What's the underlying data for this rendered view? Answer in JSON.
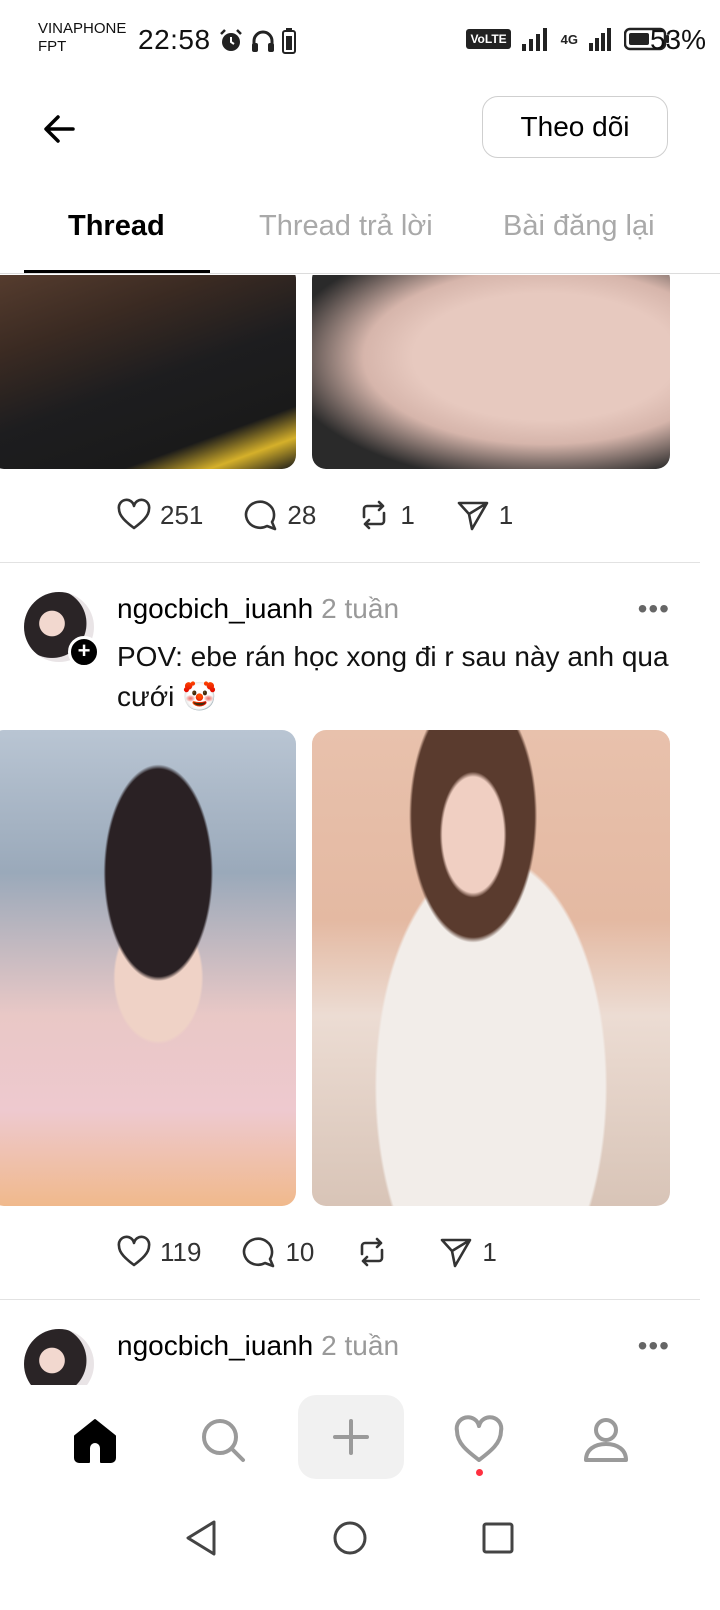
{
  "status_bar": {
    "carrier_line1": "VINAPHONE",
    "carrier_line2": "FPT",
    "time": "22:58",
    "volte": "VoLTE",
    "network": "4G",
    "battery": "53%"
  },
  "header": {
    "follow_label": "Theo dõi"
  },
  "tabs": [
    {
      "label": "Thread",
      "active": true
    },
    {
      "label": "Thread trả lời",
      "active": false
    },
    {
      "label": "Bài đăng lại",
      "active": false
    }
  ],
  "posts": [
    {
      "likes": "251",
      "comments": "28",
      "reposts": "1",
      "shares": "1"
    },
    {
      "username": "ngocbich_iuanh",
      "time_ago": "2 tuần",
      "text": "POV: ebe rán học xong  đi r sau này anh qua cưới 🤡",
      "likes": "119",
      "comments": "10",
      "reposts": "",
      "shares": "1"
    },
    {
      "username": "ngocbich_iuanh",
      "time_ago": "2 tuần"
    }
  ],
  "colors": {
    "accent": "#000000",
    "muted": "#a9a9a9",
    "notification_dot": "#ff3040"
  }
}
